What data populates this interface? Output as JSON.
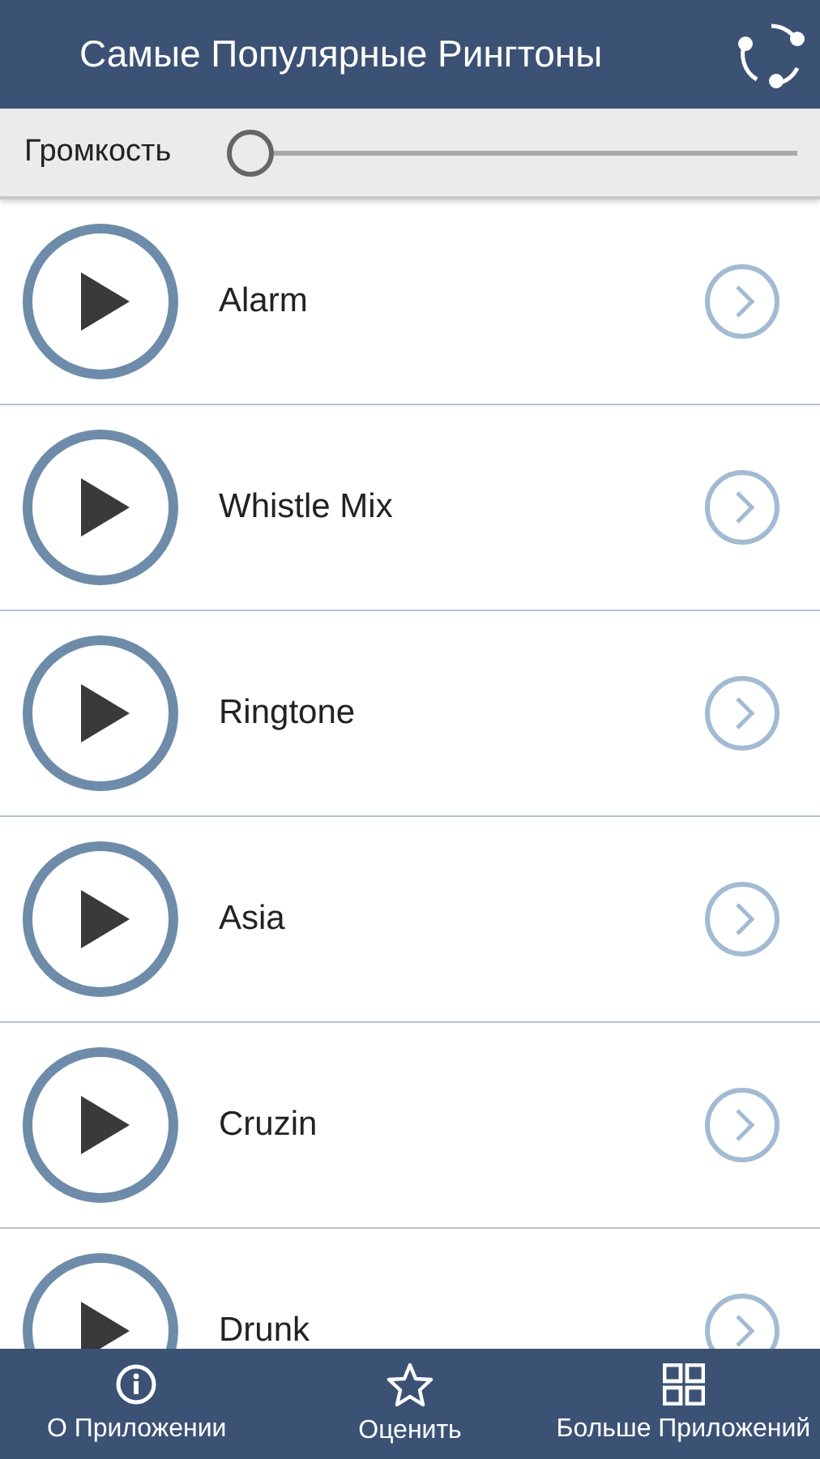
{
  "header": {
    "title": "Самые Популярные Рингтоны"
  },
  "volume": {
    "label": "Громкость",
    "level": 0
  },
  "ringtones": [
    {
      "name": "Alarm"
    },
    {
      "name": "Whistle Mix"
    },
    {
      "name": "Ringtone"
    },
    {
      "name": "Asia"
    },
    {
      "name": "Cruzin"
    },
    {
      "name": "Drunk"
    }
  ],
  "bottom_nav": [
    {
      "kind": "info",
      "label": "О Приложении"
    },
    {
      "kind": "star",
      "label": "Оценить"
    },
    {
      "kind": "grid",
      "label": "Больше Приложений"
    }
  ]
}
